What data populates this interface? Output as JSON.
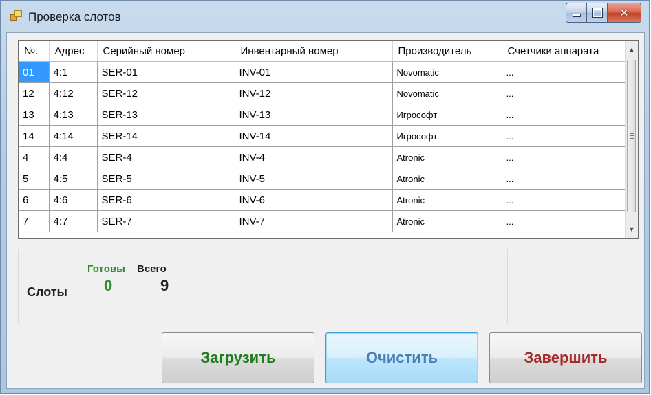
{
  "window": {
    "title": "Проверка слотов"
  },
  "grid": {
    "columns": [
      "№.",
      "Адрес",
      "Серийный номер",
      "Инвентарный номер",
      "Производитель",
      "Счетчики аппарата"
    ],
    "rows": [
      [
        "01",
        "4:1",
        "SER-01",
        "INV-01",
        "Novomatic",
        "..."
      ],
      [
        "12",
        "4:12",
        "SER-12",
        "INV-12",
        "Novomatic",
        "..."
      ],
      [
        "13",
        "4:13",
        "SER-13",
        "INV-13",
        "Игрософт",
        "..."
      ],
      [
        "14",
        "4:14",
        "SER-14",
        "INV-14",
        "Игрософт",
        "..."
      ],
      [
        "4",
        "4:4",
        "SER-4",
        "INV-4",
        "Atronic",
        "..."
      ],
      [
        "5",
        "4:5",
        "SER-5",
        "INV-5",
        "Atronic",
        "..."
      ],
      [
        "6",
        "4:6",
        "SER-6",
        "INV-6",
        "Atronic",
        "..."
      ],
      [
        "7",
        "4:7",
        "SER-7",
        "INV-7",
        "Atronic",
        "..."
      ]
    ],
    "selected_row": 0
  },
  "stats": {
    "slots_label": "Слоты",
    "ready_label": "Готовы",
    "total_label": "Всего",
    "ready_value": "0",
    "total_value": "9"
  },
  "buttons": {
    "load": "Загрузить",
    "clear": "Очистить",
    "finish": "Завершить"
  },
  "colors": {
    "ready": "#2e8b2e",
    "load_text": "#1e7d1e",
    "clear_text": "#4a7fb3",
    "finish_text": "#a52a2a",
    "selection": "#3399ff"
  },
  "icons": {
    "app": "app-window-icon",
    "minimize": "minimize-icon",
    "maximize": "maximize-icon",
    "close": "close-icon",
    "scroll_up": "arrow-up-icon",
    "scroll_down": "arrow-down-icon"
  }
}
